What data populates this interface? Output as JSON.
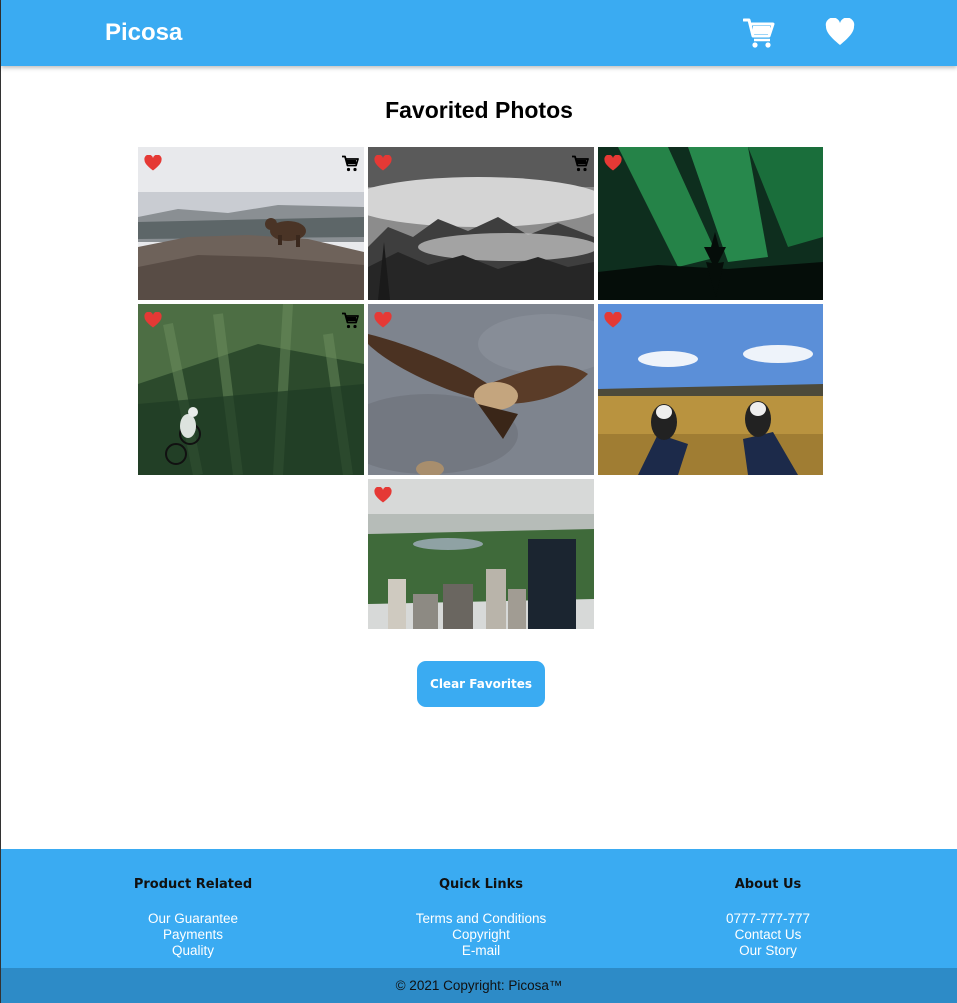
{
  "header": {
    "brand": "Picosa",
    "cart_icon": "cart-icon",
    "favorites_icon": "heart-icon"
  },
  "main": {
    "title": "Favorited Photos",
    "clear_button": "Clear Favorites",
    "photos": [
      {
        "subject": "bear",
        "favorited": true,
        "in_cart": true
      },
      {
        "subject": "misty-forest",
        "favorited": true,
        "in_cart": true
      },
      {
        "subject": "aurora",
        "favorited": true,
        "in_cart": false
      },
      {
        "subject": "mountain-biker",
        "favorited": true,
        "in_cart": true
      },
      {
        "subject": "vulture",
        "favorited": true,
        "in_cart": false
      },
      {
        "subject": "sneakers-field",
        "favorited": true,
        "in_cart": false
      },
      {
        "subject": "central-park",
        "favorited": true,
        "in_cart": false
      }
    ]
  },
  "footer": {
    "columns": [
      {
        "heading": "Product Related",
        "links": [
          "Our Guarantee",
          "Payments",
          "Quality"
        ]
      },
      {
        "heading": "Quick Links",
        "links": [
          "Terms and Conditions",
          "Copyright",
          "E-mail"
        ]
      },
      {
        "heading": "About Us",
        "links": [
          "0777-777-777",
          "Contact Us",
          "Our Story"
        ]
      }
    ],
    "copyright": "© 2021 Copyright: Picosa™"
  },
  "colors": {
    "primary": "#3aabf2",
    "copyright_bar": "#2d8bc7",
    "favorite_heart": "#e53935"
  }
}
